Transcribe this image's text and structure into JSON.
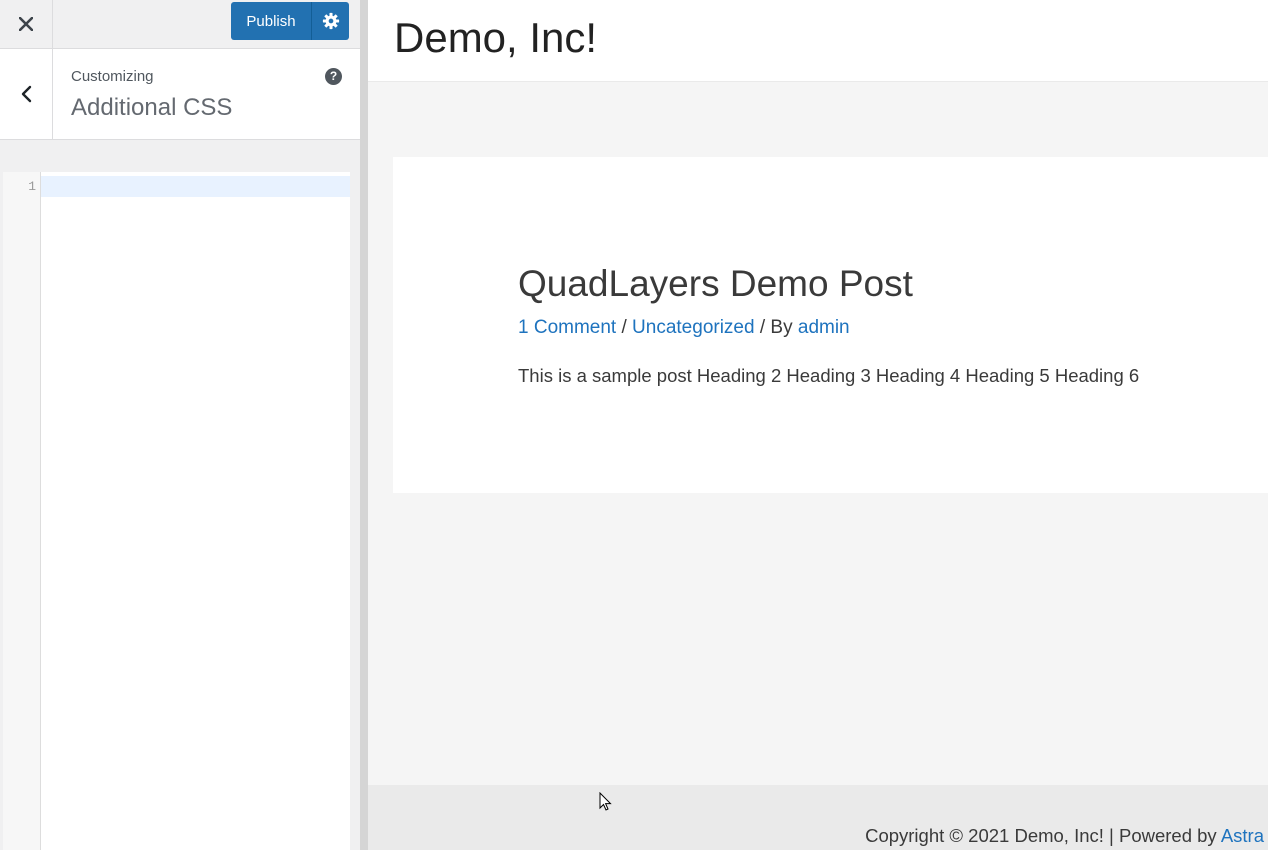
{
  "sidebar": {
    "close_label": "×",
    "publish_label": "Publish",
    "settings_icon": "gear-icon",
    "breadcrumb": "Customizing",
    "section_title": "Additional CSS",
    "help_icon": "?",
    "editor": {
      "line_numbers": [
        "1"
      ],
      "content": ""
    }
  },
  "preview": {
    "site_title": "Demo, Inc!",
    "post": {
      "title": "QuadLayers Demo Post",
      "comments_link": "1 Comment",
      "meta_sep1": " / ",
      "category_link": "Uncategorized",
      "meta_sep2": " / By ",
      "author_link": "admin",
      "excerpt": "This is a sample post Heading 2 Heading 3 Heading 4 Heading 5 Heading 6"
    },
    "footer": {
      "text": "Copyright © 2021 Demo, Inc! | Powered by ",
      "link": "Astra"
    }
  },
  "colors": {
    "accent": "#2271b1",
    "link": "#1e73be"
  }
}
